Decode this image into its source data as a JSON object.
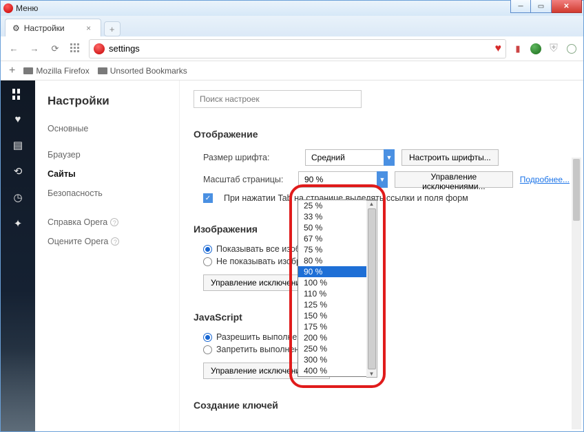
{
  "window": {
    "menu": "Меню"
  },
  "tab": {
    "title": "Настройки"
  },
  "address": {
    "value": "settings"
  },
  "bookmarks": {
    "item1": "Mozilla Firefox",
    "item2": "Unsorted Bookmarks"
  },
  "nav": {
    "heading": "Настройки",
    "items": [
      "Основные",
      "Браузер",
      "Сайты",
      "Безопасность"
    ],
    "help": "Справка Opera",
    "rate": "Оцените Opera"
  },
  "search": {
    "placeholder": "Поиск настроек"
  },
  "sections": {
    "display": {
      "title": "Отображение",
      "font_label": "Размер шрифта:",
      "font_value": "Средний",
      "font_btn": "Настроить шрифты...",
      "zoom_label": "Масштаб страницы:",
      "zoom_value": "90 %",
      "zoom_btn": "Управление исключениями...",
      "more": "Подробнее...",
      "tab_check": "При нажатии Tab на странице выделять ссылки и поля форм"
    },
    "images": {
      "title": "Изображения",
      "show": "Показывать все изображения",
      "hide": "Не показывать изображения",
      "btn": "Управление исключениями..."
    },
    "js": {
      "title": "JavaScript",
      "allow": "Разрешить выполнение JavaScript",
      "deny": "Запретить выполнение JavaScript",
      "btn": "Управление исключениями..."
    },
    "keys": {
      "title": "Создание ключей"
    }
  },
  "dropdown": {
    "options": [
      "25 %",
      "33 %",
      "50 %",
      "67 %",
      "75 %",
      "80 %",
      "90 %",
      "100 %",
      "110 %",
      "125 %",
      "150 %",
      "175 %",
      "200 %",
      "250 %",
      "300 %",
      "400 %"
    ],
    "selected": "90 %"
  }
}
